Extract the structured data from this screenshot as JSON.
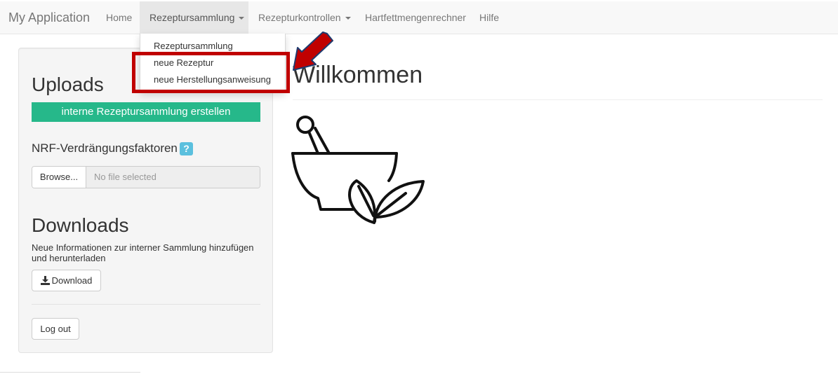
{
  "navbar": {
    "brand": "My Application",
    "items": [
      {
        "label": "Home"
      },
      {
        "label": "Rezeptursammlung"
      },
      {
        "label": "Rezepturkontrollen"
      },
      {
        "label": "Hartfettmengenrechner"
      },
      {
        "label": "Hilfe"
      }
    ]
  },
  "dropdown": {
    "items": [
      {
        "label": "Rezeptursammlung"
      },
      {
        "label": "neue Rezeptur"
      },
      {
        "label": "neue Herstellungsanweisung"
      }
    ]
  },
  "sidebar": {
    "uploads_title": "Uploads",
    "create_button": "interne Rezeptursammlung erstellen",
    "nrf_label": "NRF-Verdrängungsfaktoren",
    "help_icon": "?",
    "browse_button": "Browse...",
    "file_placeholder": "No file selected",
    "downloads_title": "Downloads",
    "downloads_description": "Neue Informationen zur interner Sammlung hinzufügen und herunterladen",
    "download_button": "Download",
    "logout_button": "Log out"
  },
  "main": {
    "title": "Willkommen"
  },
  "icons": {
    "download": "download-icon",
    "help": "question-mark-icon",
    "mortar": "mortar-pestle-leaves-icon",
    "annotation_arrow": "red-arrow-icon"
  },
  "colors": {
    "accent_green": "#26b88a",
    "help_blue": "#5bc0de",
    "annotation_red": "#c00000"
  }
}
